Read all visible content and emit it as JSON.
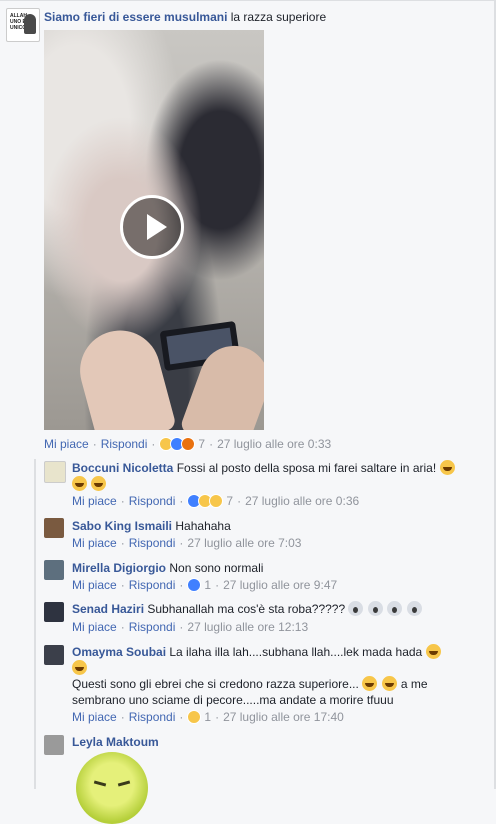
{
  "post": {
    "author": "Siamo fieri di essere musulmani",
    "text": "la razza superiore",
    "actions": {
      "like": "Mi piace",
      "reply": "Rispondi",
      "reactions_count": "7",
      "time": "27 luglio alle ore 0:33"
    }
  },
  "replies": [
    {
      "author": "Boccuni Nicoletta",
      "text": "Fossi al posto della sposa mi farei saltare in aria!",
      "like": "Mi piace",
      "reply": "Rispondi",
      "reactions_count": "7",
      "time": "27 luglio alle ore 0:36"
    },
    {
      "author": "Sabo King Ismaili",
      "text": "Hahahaha",
      "like": "Mi piace",
      "reply": "Rispondi",
      "time": "27 luglio alle ore 7:03"
    },
    {
      "author": "Mirella Digiorgio",
      "text": "Non sono normali",
      "like": "Mi piace",
      "reply": "Rispondi",
      "reactions_count": "1",
      "time": "27 luglio alle ore 9:47"
    },
    {
      "author": "Senad Haziri",
      "text": "Subhanallah ma cos'è sta roba?????",
      "like": "Mi piace",
      "reply": "Rispondi",
      "time": "27 luglio alle ore 12:13"
    },
    {
      "author": "Omayma Soubai",
      "text": "La ilaha illa lah....subhana llah....lek mada hada",
      "text2": "Questi sono gli ebrei che si credono razza superiore...",
      "text3": "a me sembrano uno sciame di pecore.....ma andate a morire tfuuu",
      "like": "Mi piace",
      "reply": "Rispondi",
      "reactions_count": "1",
      "time": "27 luglio alle ore 17:40"
    },
    {
      "author": "Leyla Maktoum"
    }
  ],
  "colors": {
    "name": "#385898",
    "link": "#4267b2",
    "meta": "#90949c",
    "background": "#f6f7f9"
  },
  "icons": [
    "play-icon",
    "haha-reaction-icon",
    "like-reaction-icon",
    "angry-reaction-icon",
    "wow-reaction-icon",
    "sad-reaction-icon",
    "laughing-emoji-icon",
    "screaming-emoji-icon"
  ]
}
